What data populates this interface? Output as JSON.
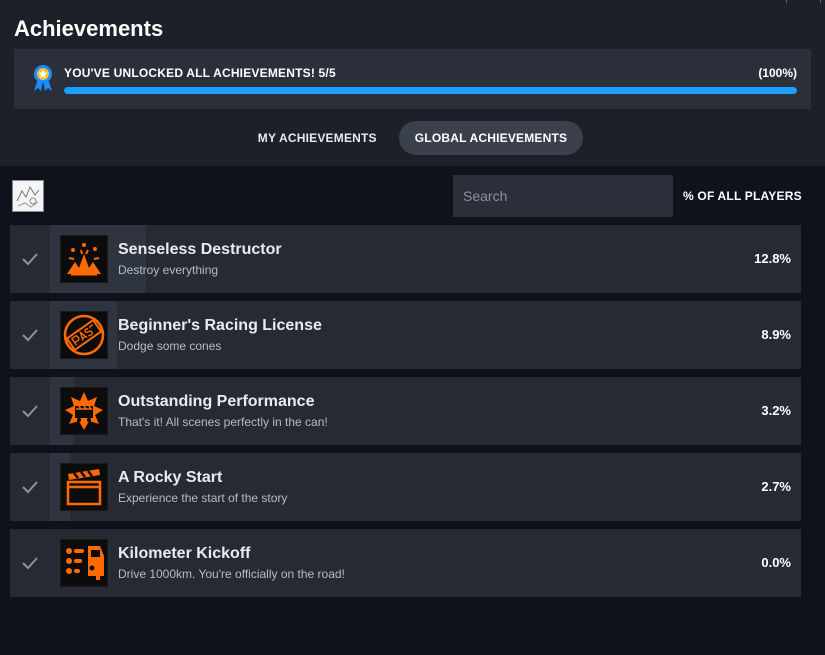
{
  "header": {
    "title": "Achievements"
  },
  "summary": {
    "text": "YOU'VE UNLOCKED ALL ACHIEVEMENTS! 5/5",
    "percent_label": "(100%)",
    "progress_fraction": 1.0,
    "icon": "medal-icon"
  },
  "tabs": [
    {
      "label": "MY ACHIEVEMENTS",
      "active": false
    },
    {
      "label": "GLOBAL ACHIEVEMENTS",
      "active": true
    }
  ],
  "controls": {
    "search_placeholder": "Search",
    "column_header": "% OF ALL PLAYERS"
  },
  "colors": {
    "accent": "#1a9fff",
    "icon_orange": "#ff6a00",
    "row_bg": "#252a33"
  },
  "achievements": [
    {
      "name": "Senseless Destructor",
      "description": "Destroy everything",
      "percent": "12.8%",
      "fraction": 0.128,
      "icon": "explosion-icon",
      "unlocked": true
    },
    {
      "name": "Beginner's Racing License",
      "description": "Dodge some cones",
      "percent": "8.9%",
      "fraction": 0.089,
      "icon": "passed-stamp-icon",
      "unlocked": true
    },
    {
      "name": "Outstanding Performance",
      "description": "That's it! All scenes perfectly in the can!",
      "percent": "3.2%",
      "fraction": 0.032,
      "icon": "clapper-burst-icon",
      "unlocked": true
    },
    {
      "name": "A Rocky Start",
      "description": "Experience the start of the story",
      "percent": "2.7%",
      "fraction": 0.027,
      "icon": "clapperboard-icon",
      "unlocked": true
    },
    {
      "name": "Kilometer Kickoff",
      "description": "Drive 1000km. You're officially on the road!",
      "percent": "0.0%",
      "fraction": 0.0,
      "icon": "car-odometer-icon",
      "unlocked": true
    }
  ]
}
